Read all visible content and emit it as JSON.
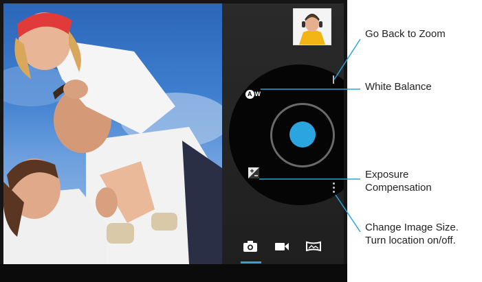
{
  "callouts": {
    "zoom": "Go Back to Zoom",
    "white_balance": "White Balance",
    "exposure_line1": "Exposure",
    "exposure_line2": "Compensation",
    "image_size_line1": "Change Image Size.",
    "image_size_line2": "Turn location on/off."
  },
  "controls": {
    "white_balance_icon_text": "A",
    "white_balance_icon_sub": "W"
  },
  "modes": [
    {
      "name": "camera",
      "active": true
    },
    {
      "name": "video",
      "active": false
    },
    {
      "name": "panorama",
      "active": false
    }
  ],
  "colors": {
    "accent": "#2aa5df",
    "panel": "#222222",
    "dial": "#050505"
  }
}
